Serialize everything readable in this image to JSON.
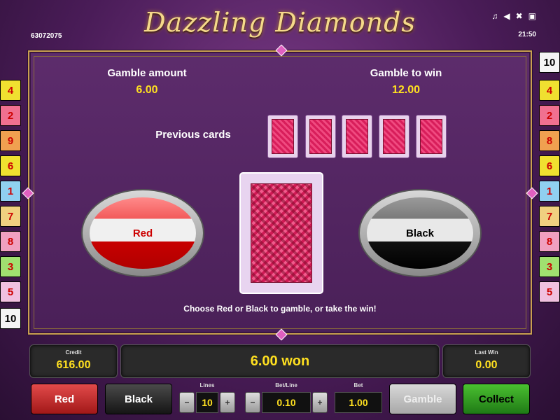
{
  "header": {
    "title": "Dazzling Diamonds",
    "machine_id": "63072075",
    "clock": "21:50",
    "icons": [
      "music-icon",
      "speaker-icon",
      "exit-icon",
      "fullscreen-icon"
    ]
  },
  "lines": {
    "left": [
      "4",
      "2",
      "9",
      "6",
      "1",
      "7",
      "8",
      "3",
      "5",
      "10"
    ],
    "right": [
      "10",
      "4",
      "2",
      "8",
      "6",
      "1",
      "7",
      "8",
      "3",
      "5"
    ]
  },
  "gamble": {
    "amount_label": "Gamble amount",
    "amount_value": "6.00",
    "towin_label": "Gamble to win",
    "towin_value": "12.00",
    "previous_label": "Previous cards",
    "red_label": "Red",
    "black_label": "Black",
    "hint": "Choose Red or Black to gamble, or take the win!"
  },
  "bottom": {
    "credit_label": "Credit",
    "credit_value": "616.00",
    "won_message": "6.00 won",
    "lastwin_label": "Last Win",
    "lastwin_value": "0.00",
    "red_button": "Red",
    "black_button": "Black",
    "lines_label": "Lines",
    "lines_value": "10",
    "betline_label": "Bet/Line",
    "betline_value": "0.10",
    "bet_label": "Bet",
    "bet_value": "1.00",
    "minus": "−",
    "plus": "+",
    "gamble_button": "Gamble",
    "collect_button": "Collect"
  },
  "colors": {
    "accent_gold": "#f5d98a",
    "value_yellow": "#ffe020",
    "panel_purple": "#5d2c6c"
  }
}
